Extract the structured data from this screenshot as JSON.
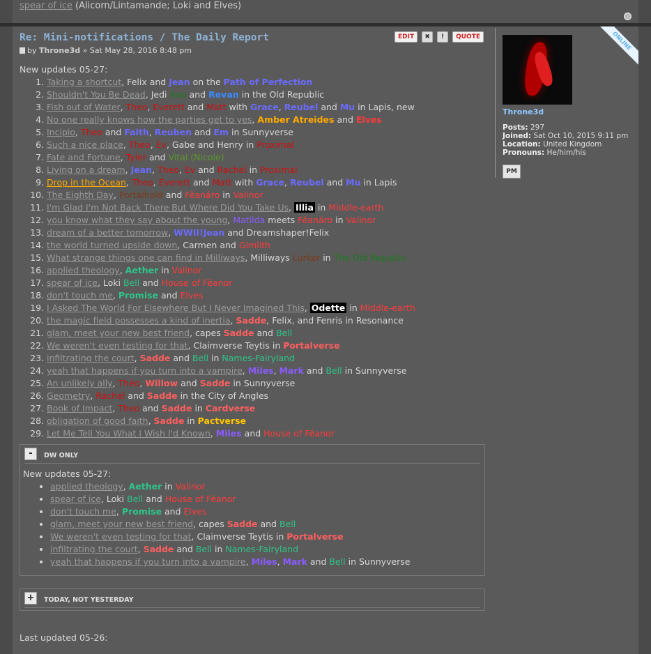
{
  "top": {
    "link": "spear of ice",
    "rest": "(Alicorn/Lintamande; Loki and Elves)"
  },
  "post": {
    "title": "Re: Mini-notifications / The Daily Report",
    "author_prefix": "by",
    "author": "Throne3d",
    "date": "» Sat May 28, 2016 8:48 pm",
    "actions": {
      "edit": "EDIT",
      "delete": "✖",
      "report": "!",
      "quote": "QUOTE"
    },
    "intro": "New updates 05-27:"
  },
  "spoiler1": {
    "toggle": "-",
    "label": "DW ONLY",
    "intro": "New updates 05-27:"
  },
  "spoiler2": {
    "toggle": "+",
    "label": "TODAY, NOT YESTERDAY"
  },
  "last_updated": "Last updated 05-26:",
  "profile": {
    "username": "Throne3d",
    "posts_label": "Posts:",
    "posts": "297",
    "joined_label": "Joined:",
    "joined": "Sat Oct 10, 2015 9:11 pm",
    "location_label": "Location:",
    "location": "United Kingdom",
    "pronouns_label": "Pronouns:",
    "pronouns": "He/him/his",
    "pm": "PM",
    "online": "ONLINE"
  },
  "colors": {
    "title": "#8fb3d6",
    "background": "#4a4a4a",
    "post_bg": "#5a5a5a"
  }
}
